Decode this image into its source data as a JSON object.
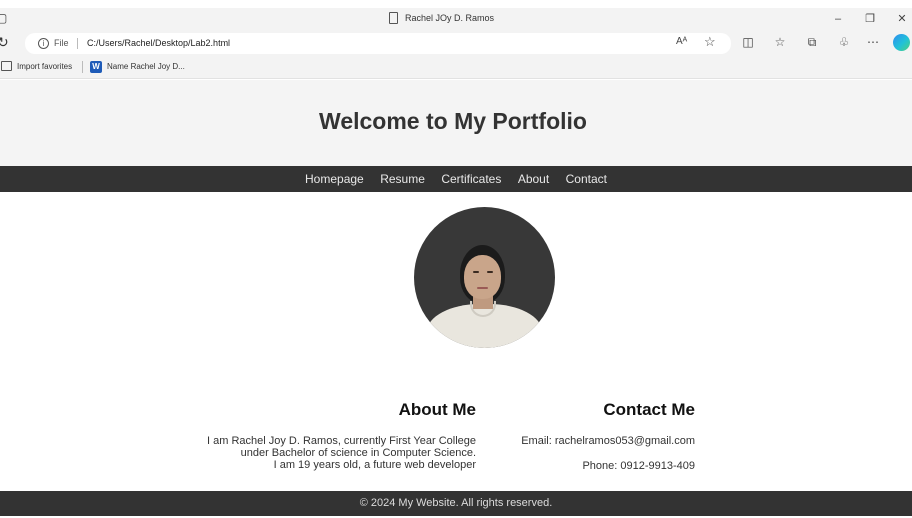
{
  "browser": {
    "window_title": "Rachel JOy D. Ramos",
    "address": {
      "scheme_label": "File",
      "url": "C:/Users/Rachel/Desktop/Lab2.html"
    },
    "bookmarks": [
      {
        "label": "Import favorites",
        "icon": "import-icon"
      },
      {
        "label": "Name Rachel Joy D...",
        "icon": "word-icon"
      }
    ],
    "icons": [
      "page-icon",
      "reload-icon",
      "info-icon",
      "read-aloud-icon",
      "favorite-star-icon",
      "split-screen-icon",
      "favorites-icon",
      "collections-icon",
      "extensions-icon",
      "more-icon",
      "copilot-icon"
    ]
  },
  "header": {
    "title": "Welcome to My Portfolio"
  },
  "nav": {
    "items": [
      {
        "label": "Homepage"
      },
      {
        "label": "Resume"
      },
      {
        "label": "Certificates"
      },
      {
        "label": "About"
      },
      {
        "label": "Contact"
      }
    ]
  },
  "about": {
    "heading": "About Me",
    "lines": [
      "I am Rachel Joy D. Ramos, currently First Year College",
      "under Bachelor of science in Computer Science.",
      "I am 19 years old, a future web developer"
    ]
  },
  "contact": {
    "heading": "Contact Me",
    "email": "Email: rachelramos053@gmail.com",
    "phone": "Phone: 0912-9913-409"
  },
  "footer": {
    "text": "© 2024 My Website. All rights reserved."
  },
  "colors": {
    "nav_bg": "#333333",
    "header_bg": "#f4f4f4",
    "footer_bg": "#333333",
    "edge_accent": "#1e5bb8"
  }
}
